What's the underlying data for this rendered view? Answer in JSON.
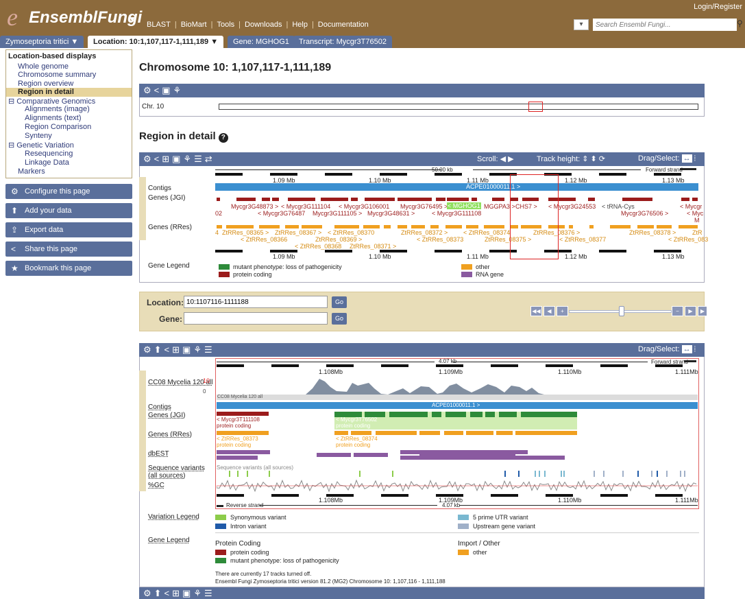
{
  "header": {
    "logo_e": "e",
    "logo_text": "EnsemblFungi",
    "nav": [
      "BLAST",
      "BioMart",
      "Tools",
      "Downloads",
      "Help",
      "Documentation"
    ],
    "login": "Login/Register",
    "search_placeholder": "Search Ensembl Fungi..."
  },
  "tabs": {
    "species": "Zymoseptoria tritici ▼",
    "location": "Location: 10:1,107,117-1,111,189 ▼",
    "gene": "Gene: MGHOG1",
    "transcript": "Transcript: Mycgr3T76502"
  },
  "sidebar": {
    "heading": "Location-based displays",
    "items": [
      {
        "label": "Whole genome"
      },
      {
        "label": "Chromosome summary"
      },
      {
        "label": "Region overview"
      },
      {
        "label": "Region in detail"
      },
      {
        "label": "Comparative Genomics"
      },
      {
        "label": "Alignments (image)"
      },
      {
        "label": "Alignments (text)"
      },
      {
        "label": "Region Comparison"
      },
      {
        "label": "Synteny"
      },
      {
        "label": "Genetic Variation"
      },
      {
        "label": "Resequencing"
      },
      {
        "label": "Linkage Data"
      },
      {
        "label": "Markers"
      }
    ],
    "buttons": [
      "Configure this page",
      "Add your data",
      "Export data",
      "Share this page",
      "Bookmark this page"
    ]
  },
  "main": {
    "title": "Chromosome 10: 1,107,117-1,111,189",
    "chr_label": "Chr. 10",
    "region_title": "Region in detail",
    "region_help": "?",
    "scroll_label": "Scroll:",
    "track_height_label": "Track height:",
    "drag_select_label": "Drag/Select:",
    "scale_label": "50.00 kb",
    "forward_strand": "Forward strand",
    "ticks": [
      "1.09 Mb",
      "1.10 Mb",
      "1.11 Mb",
      "1.12 Mb",
      "1.13 Mb"
    ],
    "tracks": [
      "Contigs",
      "Genes (JGI)",
      "Genes (RRes)",
      "Gene Legend"
    ],
    "contig": "ACPE01000011.1 >",
    "jgi_labels": [
      "02",
      "Mycgr3G48873 >",
      "< Mycgr3G76487",
      "< Mycgr3G111104",
      "Mycgr3G111105 >",
      "< Mycgr3G106001",
      "Mycgr3G48631 >",
      "Mycgr3G76495 >",
      "< MGHOG1",
      "< Mycgr3G111108",
      "MGGPA3 >",
      "CHS7 >",
      "< Mycgr3G24553",
      "< tRNA-Cys",
      "Mycgr3G76506 >",
      "< Mycgr",
      "< Myc",
      "M"
    ],
    "rres_labels": [
      "4",
      "ZtRRes_08365 >",
      "< ZtRRes_08366",
      "ZtRRes_08367 >",
      "< ZtRRes_08368",
      "ZtRRes_08369 >",
      "< ZtRRes_08370",
      "ZtRRes_08371 >",
      "ZtRRes_08372 >",
      "< ZtRRes_08373",
      "< ZtRRes_08374",
      "ZtRRes_08375 >",
      "ZtRRes_08376 >",
      "< ZtRRes_08377",
      "ZtRRes_08378 >",
      "< ZtRRes_083",
      "ZtR"
    ],
    "legend1": [
      {
        "label": "mutant phenotype: loss of pathogenicity",
        "color": "#2e8b3a"
      },
      {
        "label": "protein coding",
        "color": "#9b1c1c"
      },
      {
        "label": "other",
        "color": "#f0a020"
      },
      {
        "label": "RNA gene",
        "color": "#8a5aa0"
      }
    ],
    "location_label": "Location:",
    "location_value": "10:1107116-1111188",
    "gene_label": "Gene:",
    "go": "Go",
    "detail": {
      "scale_label": "4.07 kb",
      "forward_strand": "Forward strand",
      "reverse_strand": "Reverse strand",
      "ticks": [
        "1.108Mb",
        "1.109Mb",
        "1.110Mb",
        "1.111Mb"
      ],
      "track_rnaseq": "CC08 Mycelia 120 all",
      "rnaseq_max": "10",
      "rnaseq_min": "0",
      "rnaseq_sub": "CC08 Mycelia 120 all",
      "tracks": [
        "Contigs",
        "Genes (JGI)",
        "Genes (RRes)",
        "dbEST",
        "Sequence variants (all sources)",
        "%GC"
      ],
      "contig": "ACPE01000011.1 >",
      "jgi": [
        {
          "name": "< Mycgr3T111108",
          "biotype": "protein coding"
        },
        {
          "name": "< Mycgr3T76502",
          "biotype": "protein coding"
        }
      ],
      "rres": [
        {
          "name": "< ZtRRes_08373",
          "biotype": "protein coding"
        },
        {
          "name": "< ZtRRes_08374",
          "biotype": "protein coding"
        }
      ],
      "variants_label": "Sequence variants (all sources)",
      "variation_legend_title": "Variation Legend",
      "variation_legend": [
        {
          "label": "Synonymous variant",
          "color": "#8ccc4a"
        },
        {
          "label": "Intron variant",
          "color": "#1f5aa8"
        },
        {
          "label": "5 prime UTR variant",
          "color": "#7ab8d0"
        },
        {
          "label": "Upstream gene variant",
          "color": "#a0b0c8"
        }
      ],
      "gene_legend_title": "Gene Legend",
      "protein_coding_title": "Protein Coding",
      "import_title": "Import / Other",
      "gene_legend": [
        {
          "label": "protein coding",
          "color": "#9b1c1c"
        },
        {
          "label": "mutant phenotype: loss of pathogenicity",
          "color": "#2e8b3a"
        },
        {
          "label": "other",
          "color": "#f0a020"
        }
      ],
      "tracks_off": "There are currently 17 tracks turned off.",
      "version": "Ensembl Fungi Zymoseptoria tritici version 81.2 (MG2) Chromosome 10: 1,107,116 - 1,111,188"
    }
  }
}
